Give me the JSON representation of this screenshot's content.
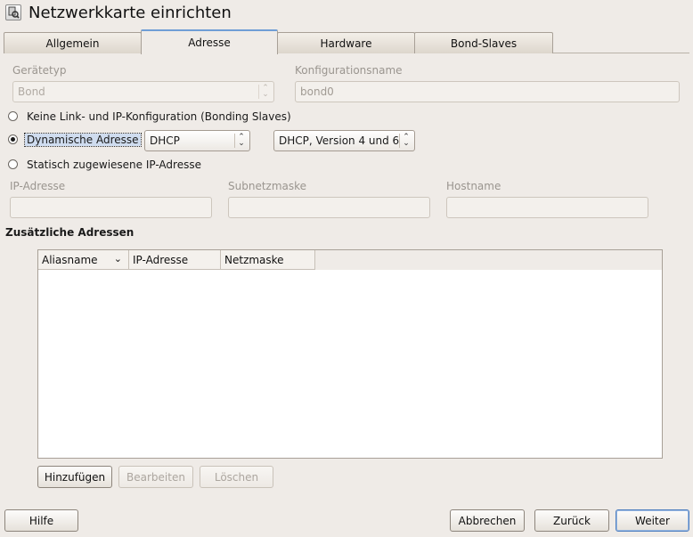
{
  "window": {
    "title": "Netzwerkkarte einrichten",
    "icon": "network-config-icon"
  },
  "tabs": [
    {
      "label": "Allgemein",
      "active": false
    },
    {
      "label": "Adresse",
      "active": true
    },
    {
      "label": "Hardware",
      "active": false
    },
    {
      "label": "Bond-Slaves",
      "active": false
    }
  ],
  "device": {
    "type_label": "Gerätetyp",
    "type_value": "Bond",
    "config_name_label": "Konfigurationsname",
    "config_name_value": "bond0"
  },
  "addressing": {
    "option_none": "Keine Link- und IP-Konfiguration (Bonding Slaves)",
    "option_dynamic": "Dynamische Adresse",
    "dynamic_method": "DHCP",
    "dhcp_version": "DHCP, Version 4 und 6",
    "option_static": "Statisch zugewiesene IP-Adresse",
    "selected": "dynamic"
  },
  "static": {
    "ip_label": "IP-Adresse",
    "ip_value": "",
    "subnet_label": "Subnetzmaske",
    "subnet_value": "",
    "hostname_label": "Hostname",
    "hostname_value": ""
  },
  "additional": {
    "heading": "Zusätzliche Adressen",
    "columns": [
      "Aliasname",
      "IP-Adresse",
      "Netzmaske"
    ],
    "rows": [],
    "add_button": "Hinzufügen",
    "edit_button": "Bearbeiten",
    "delete_button": "Löschen"
  },
  "footer": {
    "help_button": "Hilfe",
    "cancel_button": "Abbrechen",
    "back_button": "Zurück",
    "next_button": "Weiter"
  },
  "colors": {
    "background": "#efebe7",
    "active_tab_accent": "#6f9ed6",
    "focus_highlight": "#cfdcef"
  }
}
